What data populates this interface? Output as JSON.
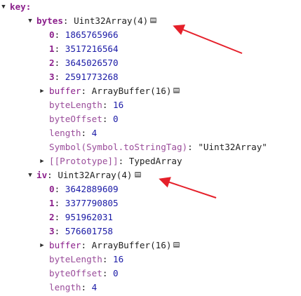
{
  "root": {
    "label": "key:"
  },
  "bytes": {
    "key": "bytes",
    "type": "Uint32Array(4)",
    "items": [
      {
        "index": "0",
        "value": "1865765966"
      },
      {
        "index": "1",
        "value": "3517216564"
      },
      {
        "index": "2",
        "value": "3645026570"
      },
      {
        "index": "3",
        "value": "2591773268"
      }
    ],
    "buffer_key": "buffer",
    "buffer_type": "ArrayBuffer(16)",
    "byteLength_key": "byteLength",
    "byteLength_value": "16",
    "byteOffset_key": "byteOffset",
    "byteOffset_value": "0",
    "length_key": "length",
    "length_value": "4",
    "symbol_key": "Symbol(Symbol.toStringTag)",
    "symbol_value": "\"Uint32Array\"",
    "prototype_key": "[[Prototype]]",
    "prototype_value": "TypedArray"
  },
  "iv": {
    "key": "iv",
    "type": "Uint32Array(4)",
    "items": [
      {
        "index": "0",
        "value": "3642889609"
      },
      {
        "index": "1",
        "value": "3377790805"
      },
      {
        "index": "2",
        "value": "951962031"
      },
      {
        "index": "3",
        "value": "576601758"
      }
    ],
    "buffer_key": "buffer",
    "buffer_type": "ArrayBuffer(16)",
    "byteLength_key": "byteLength",
    "byteLength_value": "16",
    "byteOffset_key": "byteOffset",
    "byteOffset_value": "0",
    "length_key": "length",
    "length_value": "4"
  },
  "colors": {
    "arrow": "#e5202a",
    "key": "#8b1f8b",
    "number": "#1a1aa6"
  },
  "icons": {
    "expanded": "triangle-down-icon",
    "collapsed": "triangle-right-icon",
    "memory": "memory-inspector-icon"
  }
}
